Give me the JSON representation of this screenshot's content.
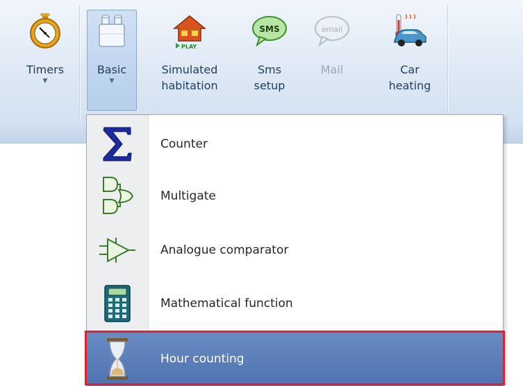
{
  "ribbon": {
    "buttons": [
      {
        "label": "Timers",
        "icon": "stopwatch-icon",
        "has_caret": true
      },
      {
        "label": "Basic",
        "icon": "blocks-icon",
        "has_caret": true,
        "active": true
      },
      {
        "label": "Simulated\nhabitation",
        "icon": "house-play-icon",
        "play_text": "PLAY"
      },
      {
        "label": "Sms\nsetup",
        "icon": "sms-bubble-icon",
        "bubble_text": "SMS"
      },
      {
        "label": "Mail",
        "icon": "email-bubble-icon",
        "bubble_text": "email",
        "disabled": true
      },
      {
        "label": "Car\nheating",
        "icon": "car-heating-icon"
      }
    ]
  },
  "menu": {
    "items": [
      {
        "label": "Counter",
        "icon": "sigma-icon"
      },
      {
        "label": "Multigate",
        "icon": "logic-gates-icon"
      },
      {
        "label": "Analogue comparator",
        "icon": "comparator-icon"
      },
      {
        "label": "Mathematical function",
        "icon": "calculator-icon"
      },
      {
        "label": "Hour counting",
        "icon": "hourglass-icon",
        "selected": true
      }
    ]
  },
  "colors": {
    "highlight": "#e3202c",
    "selected_item": "#5b7fbb",
    "ribbon": "#dfe9f5"
  }
}
